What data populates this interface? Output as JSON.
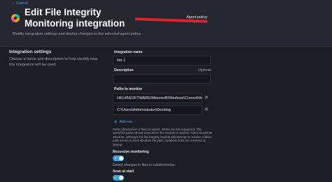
{
  "header": {
    "cancel_label": "Cancel",
    "title": "Edit File Integrity Monitoring integration",
    "subtitle": "Modify integration settings and deploy changes to the selected agent policy.",
    "policy_label": "Agent policy"
  },
  "section": {
    "title": "Integration settings",
    "description": "Choose a name and description to help identify how this integration will be used."
  },
  "form": {
    "name_label": "Integration name",
    "name_value": "fim-1",
    "description_label": "Description",
    "description_optional": "Optional",
    "description_value": "",
    "paths_label": "Paths to monitor",
    "paths": [
      "HKLM\\SOFTWARE\\Microsoft\\Windows\\CurrentVersic",
      "C:\\Users\\Administrator\\Desktop"
    ],
    "add_row_label": "Add row",
    "paths_help": "Paths (directories or files) to watch. Globs are not supported. The specified paths should exist when this module is started. Paths should be absolute, although the file integrity module will attempt to resolve relative path events to their absolute file path. Symbolic links are resolved at startup.",
    "recursive_label": "Recursive monitoring",
    "recursive_on": true,
    "recursive_help": "Detect changes to files in subdirectories.",
    "scan_label": "Scan at start",
    "scan_on": true
  },
  "colors": {
    "accent": "#36a2ef",
    "background": "#1d1e24",
    "header_background": "#25262e",
    "redaction": "#e0202a"
  }
}
